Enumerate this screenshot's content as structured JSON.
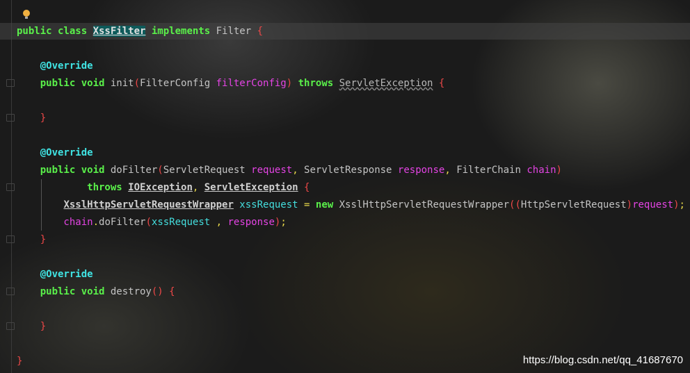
{
  "editor": {
    "lines": [
      [],
      [
        [
          "public class ",
          "kw"
        ],
        [
          "XssFilter",
          "hl"
        ],
        [
          " implements ",
          "kw"
        ],
        [
          "Filter ",
          "pl"
        ],
        [
          "{",
          "br"
        ]
      ],
      [],
      [
        [
          "    @Override",
          "an"
        ]
      ],
      [
        [
          "    public void ",
          "kw"
        ],
        [
          "init",
          "pl"
        ],
        [
          "(",
          "br"
        ],
        [
          "FilterConfig ",
          "pl"
        ],
        [
          "filterConfig",
          "pa"
        ],
        [
          ")",
          "br"
        ],
        [
          " throws ",
          "kw"
        ],
        [
          "ServletException",
          "cw"
        ],
        [
          " {",
          "br"
        ]
      ],
      [],
      [
        [
          "    }",
          "br"
        ]
      ],
      [],
      [
        [
          "    @Override",
          "an"
        ]
      ],
      [
        [
          "    public void ",
          "kw"
        ],
        [
          "doFilter",
          "pl"
        ],
        [
          "(",
          "br"
        ],
        [
          "ServletRequest ",
          "pl"
        ],
        [
          "request",
          "pa"
        ],
        [
          ", ",
          "pu"
        ],
        [
          "ServletResponse ",
          "pl"
        ],
        [
          "response",
          "pa"
        ],
        [
          ", ",
          "pu"
        ],
        [
          "FilterChain ",
          "pl"
        ],
        [
          "chain",
          "pa"
        ],
        [
          ")",
          "br"
        ]
      ],
      [
        [
          "            throws ",
          "kw"
        ],
        [
          "IOException",
          "cu"
        ],
        [
          ", ",
          "pu"
        ],
        [
          "ServletException",
          "cu"
        ],
        [
          " {",
          "br"
        ]
      ],
      [
        [
          "        ",
          "pl"
        ],
        [
          "XsslHttpServletRequestWrapper",
          "cu"
        ],
        [
          " xssRequest ",
          "lv"
        ],
        [
          "= ",
          "pu"
        ],
        [
          "new ",
          "kw"
        ],
        [
          "XsslHttpServletRequestWrapper",
          "pl"
        ],
        [
          "((",
          "br"
        ],
        [
          "HttpServletRequest",
          "pl"
        ],
        [
          ")",
          "br"
        ],
        [
          "request",
          "pa"
        ],
        [
          ")",
          "br"
        ],
        [
          ";",
          "pu"
        ]
      ],
      [
        [
          "        chain",
          "pa"
        ],
        [
          ".",
          "pu"
        ],
        [
          "doFilter",
          "pl"
        ],
        [
          "(",
          "br"
        ],
        [
          "xssRequest ",
          "lv"
        ],
        [
          ", ",
          "pu"
        ],
        [
          "response",
          "pa"
        ],
        [
          ")",
          "br"
        ],
        [
          ";",
          "pu"
        ]
      ],
      [
        [
          "    }",
          "br"
        ]
      ],
      [],
      [
        [
          "    @Override",
          "an"
        ]
      ],
      [
        [
          "    public void ",
          "kw"
        ],
        [
          "destroy",
          "pl"
        ],
        [
          "()",
          "br"
        ],
        [
          " {",
          "br"
        ]
      ],
      [],
      [
        [
          "    }",
          "br"
        ]
      ],
      [],
      [
        [
          "}",
          "br"
        ]
      ]
    ]
  },
  "watermark": "https://blog.csdn.net/qq_41687670",
  "icons": {
    "intention": "lightbulb-icon",
    "fold": "fold-marker-icon"
  }
}
